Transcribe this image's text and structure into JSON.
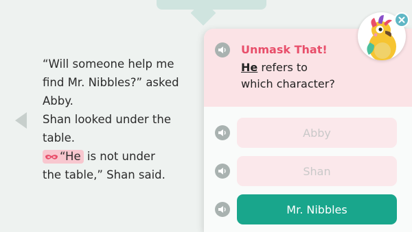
{
  "story": {
    "lines": [
      "“Will someone help me",
      "find Mr. Nibbles?” asked",
      "Abby.",
      "Shan looked under the",
      "table."
    ],
    "highlight_word": "“He",
    "line6_rest": " is not under",
    "line7": "the table,” Shan said."
  },
  "question": {
    "title": "Unmask That!",
    "pronoun": "He",
    "prompt_rest": " refers to",
    "prompt_line2": "which character?"
  },
  "answers": [
    {
      "label": "Abby",
      "selected": false
    },
    {
      "label": "Shan",
      "selected": false
    },
    {
      "label": "Mr. Nibbles",
      "selected": true
    }
  ],
  "icons": {
    "speaker": "speaker-icon",
    "mask": "mask-icon",
    "close": "close-icon",
    "mascot": "bird-mascot-icon",
    "prev": "previous-arrow-icon"
  },
  "colors": {
    "accent_pink": "#e84e6a",
    "header_bg": "#fbe3e6",
    "option_bg": "#fbe8eb",
    "selected_teal": "#19a68c",
    "mask_highlight": "#f8c7cf",
    "close_blue": "#5fb7c5"
  }
}
